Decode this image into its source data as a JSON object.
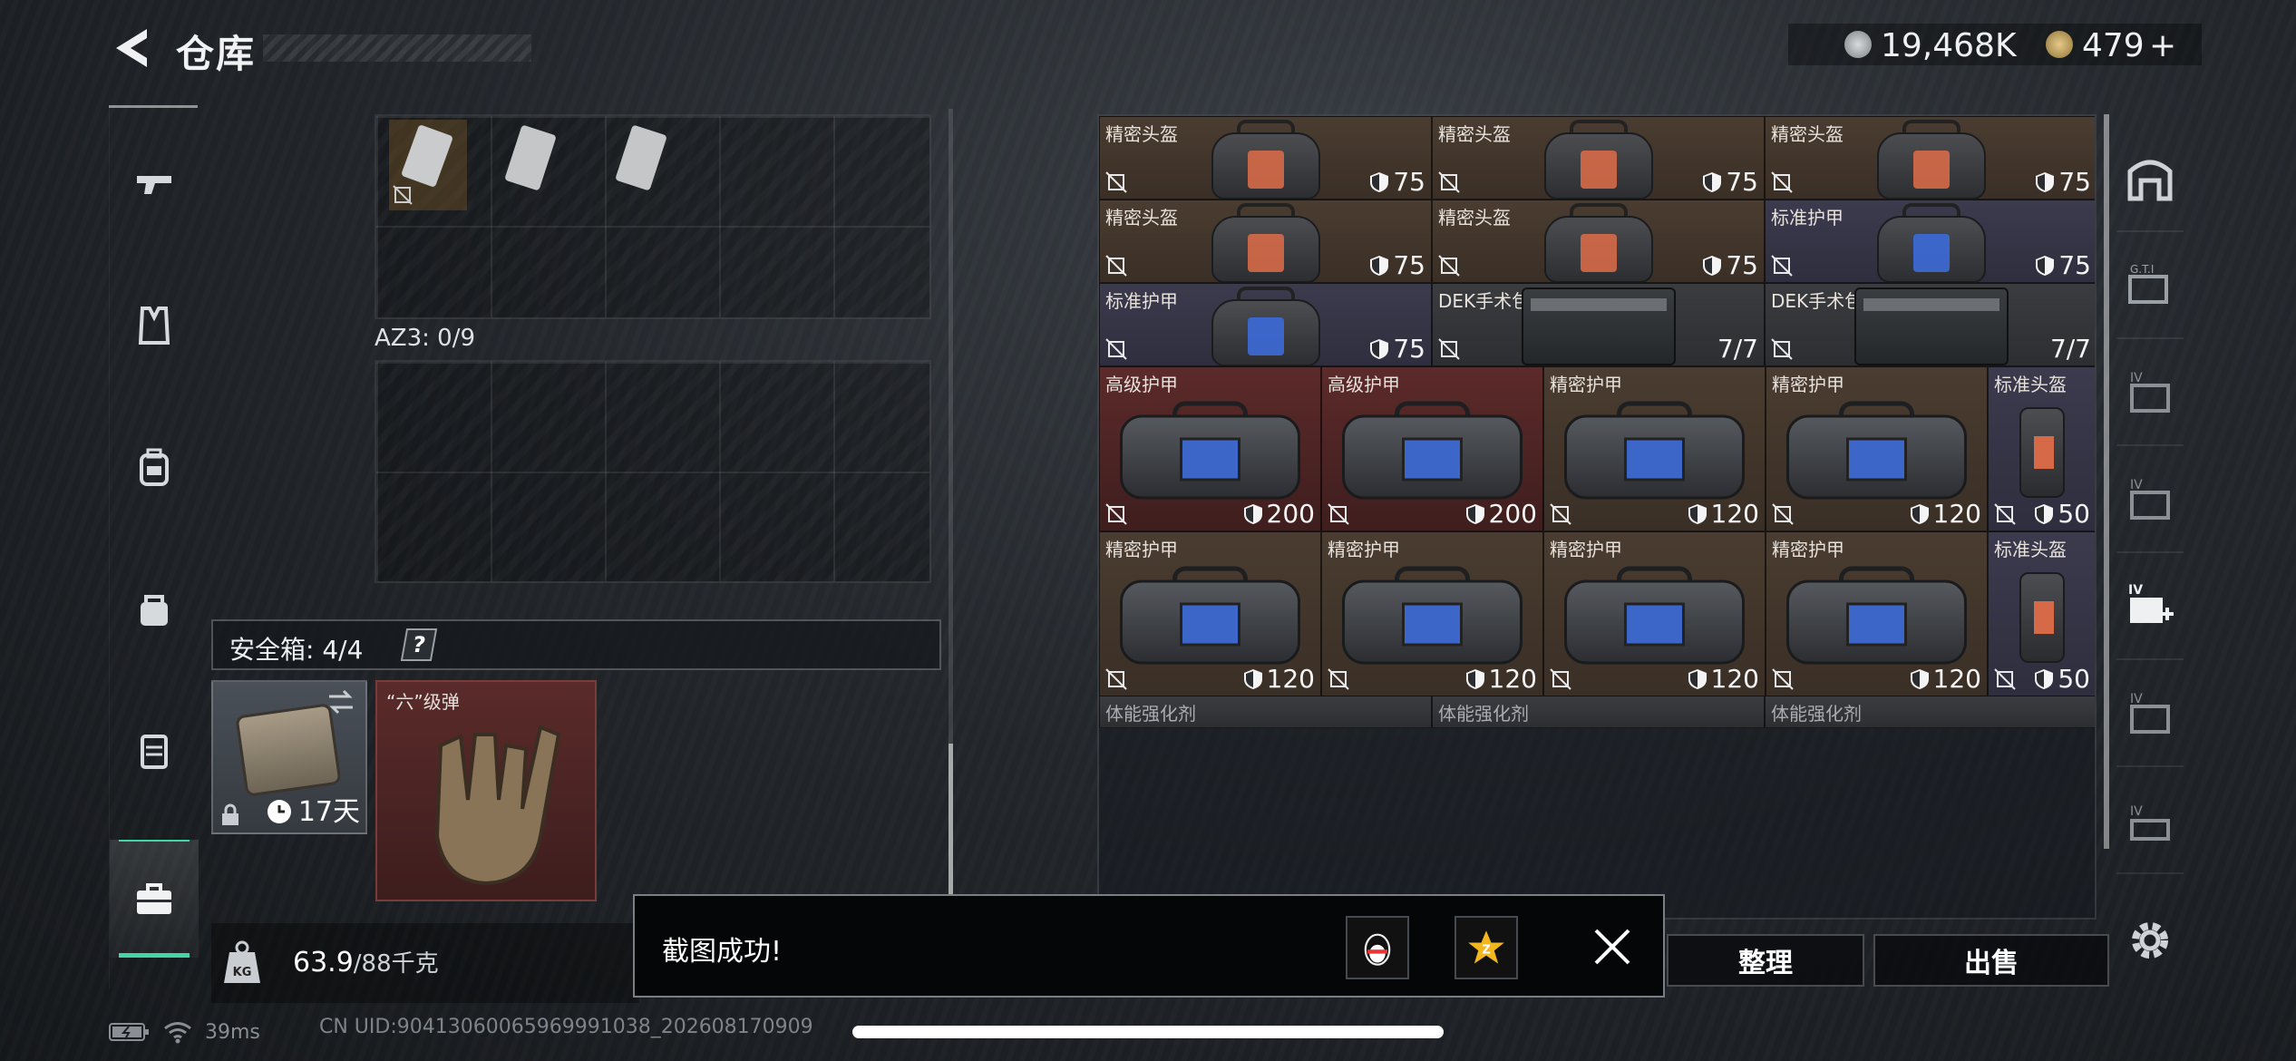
{
  "header": {
    "title": "仓库",
    "currency_1": "19,468K",
    "currency_2": "479",
    "currency_2_add": "+"
  },
  "left_panel": {
    "container_label": "AZ3: 0/9",
    "safe_box_label": "安全箱: 4/4",
    "safe_box_help": "?",
    "safe_box_timer": "17天",
    "ammo_label": "“六”级弹",
    "weight_value": "63.9",
    "weight_unit": "/88千克"
  },
  "inventory": {
    "rows": [
      [
        {
          "name": "精密头盔",
          "value": "75",
          "kind": "helmet",
          "color": "brown"
        },
        {
          "name": "精密头盔",
          "value": "75",
          "kind": "helmet",
          "color": "brown"
        },
        {
          "name": "精密头盔",
          "value": "75",
          "kind": "helmet",
          "color": "brown"
        }
      ],
      [
        {
          "name": "精密头盔",
          "value": "75",
          "kind": "helmet",
          "color": "brown"
        },
        {
          "name": "精密头盔",
          "value": "75",
          "kind": "helmet",
          "color": "brown"
        },
        {
          "name": "标准护甲",
          "value": "75",
          "kind": "helmet-blue",
          "color": "purple"
        }
      ],
      [
        {
          "name": "标准护甲",
          "value": "75",
          "kind": "helmet-blue",
          "color": "purple"
        },
        {
          "name": "DEK手术包",
          "value": "7/7",
          "kind": "medkit",
          "color": "dark"
        },
        {
          "name": "DEK手术包",
          "value": "7/7",
          "kind": "medkit",
          "color": "dark"
        }
      ],
      [
        {
          "name": "高级护甲",
          "value": "200",
          "kind": "bag",
          "color": "red"
        },
        {
          "name": "高级护甲",
          "value": "200",
          "kind": "bag",
          "color": "red"
        },
        {
          "name": "精密护甲",
          "value": "120",
          "kind": "bag",
          "color": "brown"
        },
        {
          "name": "精密护甲",
          "value": "120",
          "kind": "bag",
          "color": "brown"
        },
        {
          "name": "标准头盔",
          "value": "50",
          "kind": "small",
          "color": "purple"
        }
      ],
      [
        {
          "name": "精密护甲",
          "value": "120",
          "kind": "bag",
          "color": "brown"
        },
        {
          "name": "精密护甲",
          "value": "120",
          "kind": "bag",
          "color": "brown"
        },
        {
          "name": "精密护甲",
          "value": "120",
          "kind": "bag",
          "color": "brown"
        },
        {
          "name": "精密护甲",
          "value": "120",
          "kind": "bag",
          "color": "brown"
        },
        {
          "name": "标准头盔",
          "value": "50",
          "kind": "small",
          "color": "purple"
        }
      ],
      [
        {
          "name": "体能强化剂"
        },
        {
          "name": "体能强化剂"
        },
        {
          "name": "体能强化剂"
        }
      ]
    ]
  },
  "buttons": {
    "tidy": "整理",
    "sell": "出售"
  },
  "toast": {
    "message": "截图成功!"
  },
  "status": {
    "ping": "39ms",
    "uid": "CN UID:9041306006596999103​8_202608170909"
  },
  "colors": {
    "accent": "#42d6a4",
    "brown_cell": "#4a3c30",
    "purple_cell": "#3c3b4e",
    "red_cell": "#5c2a2a"
  }
}
